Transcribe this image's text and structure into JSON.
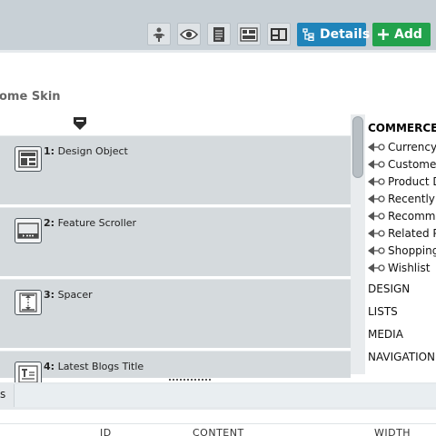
{
  "toolbar": {
    "details_label": "Details",
    "add_label": "Add"
  },
  "page": {
    "title": "ome Skin"
  },
  "objects": [
    {
      "number": "1",
      "name": "Design Object"
    },
    {
      "number": "2",
      "name": "Feature Scroller"
    },
    {
      "number": "3",
      "name": "Spacer"
    },
    {
      "number": "4",
      "name": "Latest Blogs Title"
    }
  ],
  "panel": {
    "heading": "COMMERCE",
    "items": [
      "Currency",
      "Customer",
      "Product D",
      "Recently",
      "Recomme",
      "Related P",
      "Shopping",
      "Wishlist"
    ],
    "categories": [
      "DESIGN",
      "LISTS",
      "MEDIA",
      "NAVIGATION"
    ]
  },
  "bottom": {
    "left_text": "s"
  },
  "table": {
    "headers": [
      "ID",
      "CONTENT",
      "WIDTH"
    ]
  },
  "colors": {
    "details": "#1f84ba",
    "add": "#22a24c",
    "object_bg": "#d5dadd"
  }
}
